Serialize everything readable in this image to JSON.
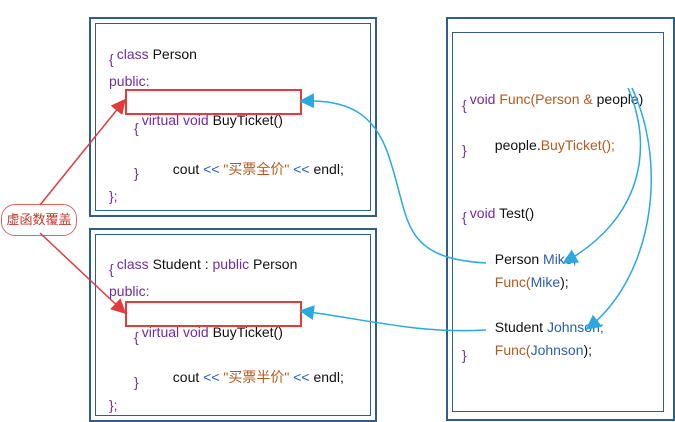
{
  "person_class": {
    "l1": {
      "kw": "class",
      "name": "Person"
    },
    "l2": "{",
    "l3": "public:",
    "l4": {
      "kw": "virtual void",
      "fn": "BuyTicket()"
    },
    "l5": "{",
    "l6": {
      "a": "cout",
      "op1": "<<",
      "str": "\"买票全价\"",
      "op2": "<<",
      "b": "endl;"
    },
    "l7": "}",
    "l8": "};"
  },
  "student_class": {
    "l1": {
      "kw": "class",
      "name": "Student",
      "colon": ":",
      "pub": "public",
      "base": "Person"
    },
    "l2": "{",
    "l3": "public:",
    "l4": {
      "kw": "virtual void",
      "fn": "BuyTicket()"
    },
    "l5": "{",
    "l6": {
      "a": "cout",
      "op1": "<<",
      "str": "\"买票半价\"",
      "op2": "<<",
      "b": "endl;"
    },
    "l7": "}",
    "l8": "};"
  },
  "right_code": {
    "l1": {
      "kw": "void",
      "fn": "Func",
      "p1": "(Person &",
      "p2": "people)"
    },
    "l2": "{",
    "l3": {
      "obj": "people.",
      "call": "BuyTicket();"
    },
    "l4": "}",
    "l5": {
      "kw": "void",
      "fn": "Test()"
    },
    "l6": "{",
    "l7": {
      "type": "Person",
      "var": "Mike;"
    },
    "l8": {
      "fn": "Func(",
      "var": "Mike",
      ",": ");"
    },
    "l9": {
      "type": "Student",
      "var": "Johnson;"
    },
    "l10": {
      "fn": "Func(",
      "var": "Johnson",
      ",": ");"
    },
    "l11": "}"
  },
  "label": "虚函数覆盖",
  "colors": {
    "frame": "#2e5f8c",
    "highlight": "#e23b3b",
    "arrow_blue": "#29a9e0",
    "arrow_red": "#e23b3b"
  }
}
